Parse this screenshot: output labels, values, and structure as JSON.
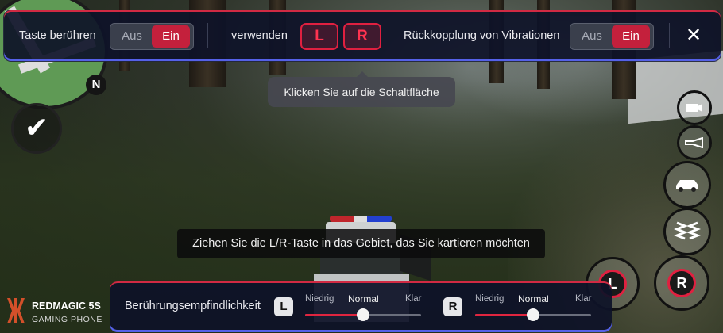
{
  "top_panel": {
    "touch_label": "Taste berühren",
    "touch_off": "Aus",
    "touch_on": "Ein",
    "use_label": "verwenden",
    "left_key": "L",
    "right_key": "R",
    "vibration_label": "Rückkopplung von Vibrationen",
    "vibration_off": "Aus",
    "vibration_on": "Ein",
    "close_glyph": "✕"
  },
  "tooltip": {
    "text": "Klicken Sie auf die Schaltfläche"
  },
  "hint": {
    "text": "Ziehen Sie die L/R-Taste in das Gebiet, das Sie kartieren möchten"
  },
  "bottom_panel": {
    "sensitivity_label": "Berührungsempfindlichkeit",
    "left": {
      "badge": "L",
      "low": "Niedrig",
      "mid": "Normal",
      "high": "Klar",
      "level": 0.5
    },
    "right": {
      "badge": "R",
      "low": "Niedrig",
      "mid": "Normal",
      "high": "Klar",
      "level": 0.5
    }
  },
  "brand": {
    "name": "REDMAGIC 5S",
    "sub": "GAMING PHONE"
  },
  "game_hud": {
    "compass": "N",
    "confirm_glyph": "✔",
    "left_trigger": "L",
    "right_trigger": "R"
  },
  "colors": {
    "accent_red": "#c4203c",
    "accent_blue": "#5561e8",
    "panel": "#0e1228"
  }
}
